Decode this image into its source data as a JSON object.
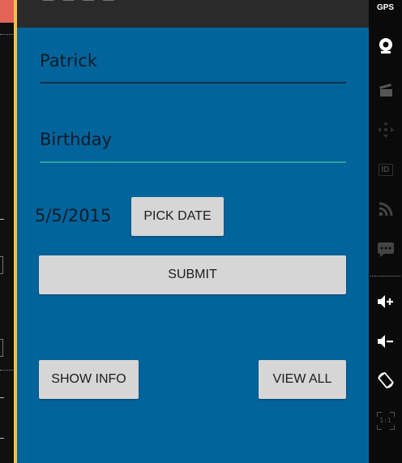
{
  "form": {
    "name_value": "Patrick",
    "birthday_placeholder": "Birthday",
    "date_value": "5/5/2015",
    "pick_date_label": "PICK DATE",
    "submit_label": "SUBMIT",
    "show_info_label": "SHOW INFO",
    "view_all_label": "VIEW ALL"
  },
  "sidebar": {
    "gps_label": "GPS",
    "id_label": "ID",
    "scale_label": "1:1"
  },
  "colors": {
    "app_background": "#03649c",
    "underline_focused": "#1fa39a",
    "button_background": "#d6d6d6"
  },
  "icons": [
    "gps-icon",
    "webcam-icon",
    "movie-clapper-icon",
    "dpad-icon",
    "id-icon",
    "rss-icon",
    "sms-icon",
    "volume-up-icon",
    "volume-down-icon",
    "rotate-icon",
    "scale-icon"
  ]
}
